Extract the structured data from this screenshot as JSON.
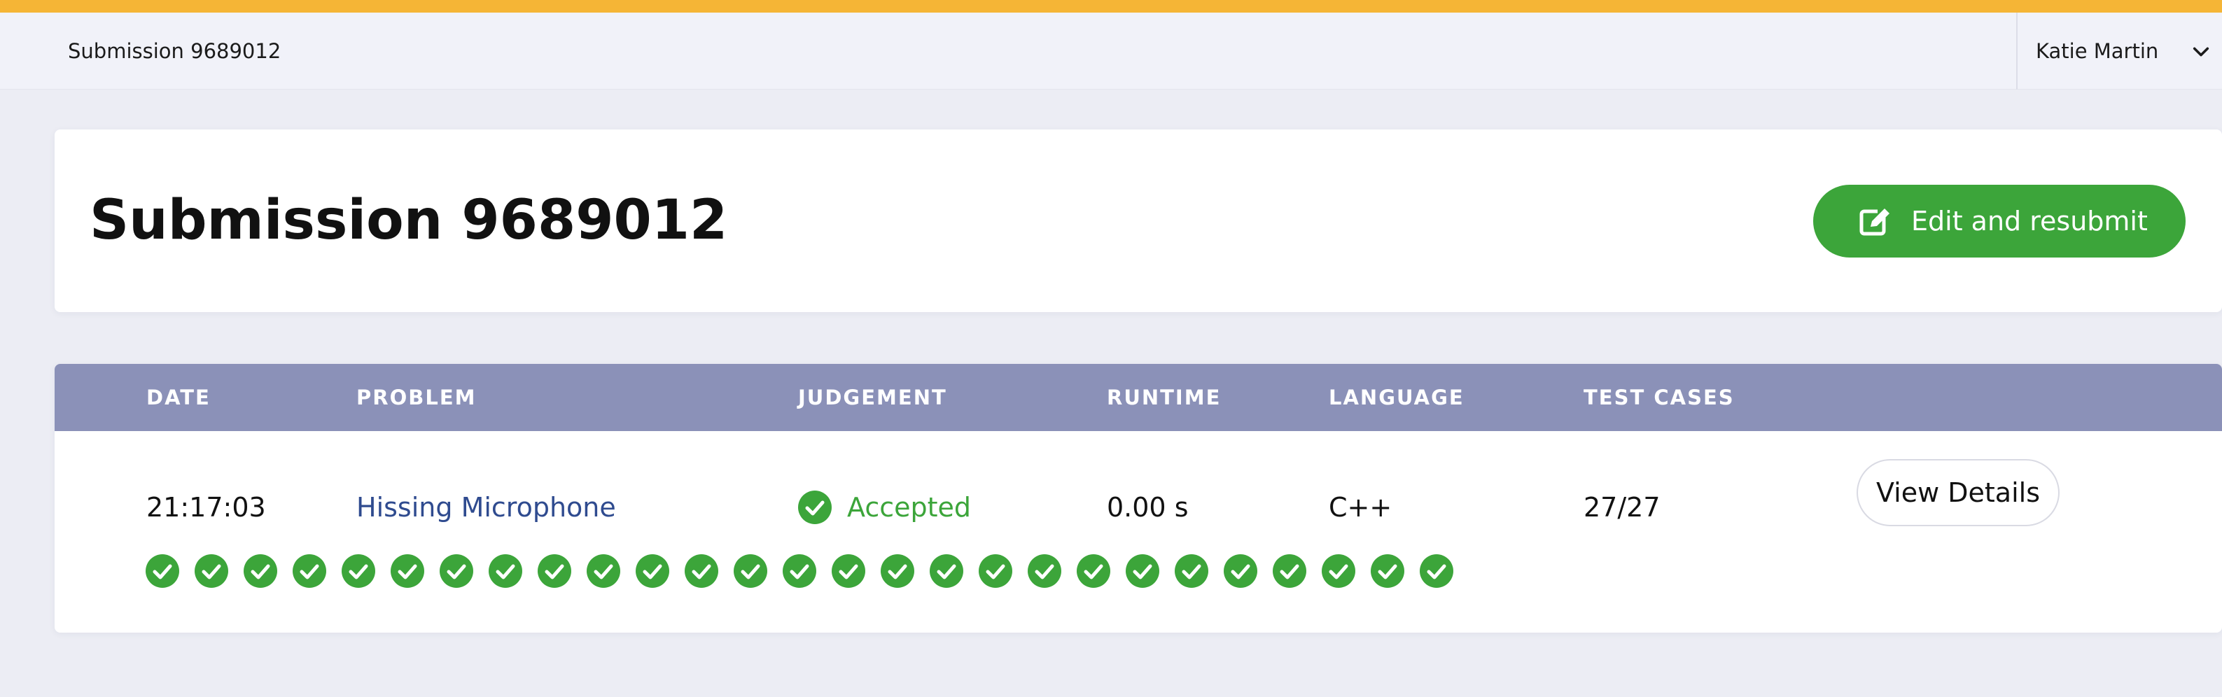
{
  "colors": {
    "accent_bar": "#f5b536",
    "success": "#3ca53a",
    "table_header": "#8b91b8",
    "link": "#2f4b8f"
  },
  "topbar": {
    "breadcrumb": "Submission 9689012",
    "user_name": "Katie Martin",
    "user_menu_icon": "chevron-down-icon"
  },
  "header": {
    "title": "Submission 9689012",
    "resubmit_label": "Edit and resubmit",
    "resubmit_icon": "edit-icon"
  },
  "table": {
    "columns": [
      "DATE",
      "PROBLEM",
      "JUDGEMENT",
      "RUNTIME",
      "LANGUAGE",
      "TEST CASES"
    ],
    "rows": [
      {
        "date": "21:17:03",
        "problem": "Hissing Microphone",
        "judgement": "Accepted",
        "judgement_icon": "check-circle-icon",
        "runtime": "0.00 s",
        "language": "C++",
        "test_cases": "27/27",
        "action_label": "View Details",
        "test_case_results": [
          "passed",
          "passed",
          "passed",
          "passed",
          "passed",
          "passed",
          "passed",
          "passed",
          "passed",
          "passed",
          "passed",
          "passed",
          "passed",
          "passed",
          "passed",
          "passed",
          "passed",
          "passed",
          "passed",
          "passed",
          "passed",
          "passed",
          "passed",
          "passed",
          "passed",
          "passed",
          "passed"
        ]
      }
    ]
  }
}
